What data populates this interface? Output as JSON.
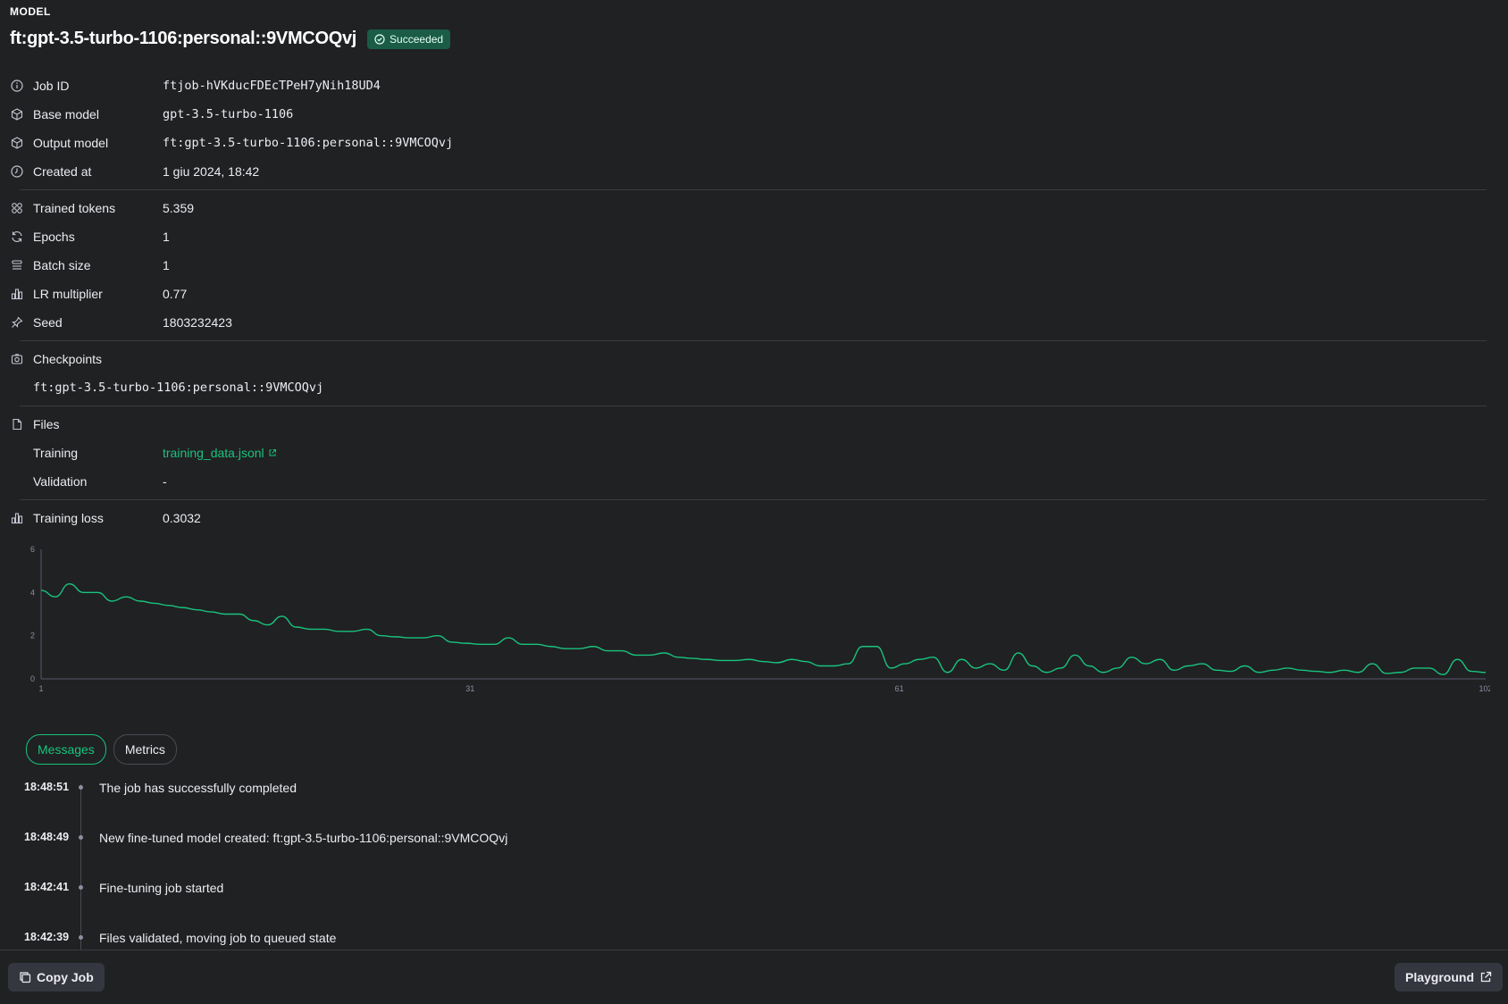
{
  "header": {
    "section_label": "MODEL",
    "title": "ft:gpt-3.5-turbo-1106:personal::9VMCOQvj",
    "status_badge": "Succeeded"
  },
  "properties": {
    "job_id": {
      "label": "Job ID",
      "value": "ftjob-hVKducFDEcTPeH7yNih18UD4"
    },
    "base_model": {
      "label": "Base model",
      "value": "gpt-3.5-turbo-1106"
    },
    "output_model": {
      "label": "Output model",
      "value": "ft:gpt-3.5-turbo-1106:personal::9VMCOQvj"
    },
    "created_at": {
      "label": "Created at",
      "value": "1 giu 2024, 18:42"
    },
    "trained_tokens": {
      "label": "Trained tokens",
      "value": "5.359"
    },
    "epochs": {
      "label": "Epochs",
      "value": "1"
    },
    "batch_size": {
      "label": "Batch size",
      "value": "1"
    },
    "lr_multiplier": {
      "label": "LR multiplier",
      "value": "0.77"
    },
    "seed": {
      "label": "Seed",
      "value": "1803232423"
    },
    "checkpoints": {
      "label": "Checkpoints",
      "value": "ft:gpt-3.5-turbo-1106:personal::9VMCOQvj"
    },
    "files": {
      "label": "Files",
      "training_label": "Training",
      "training_value": "training_data.jsonl",
      "validation_label": "Validation",
      "validation_value": "-"
    },
    "training_loss": {
      "label": "Training loss",
      "value": "0.3032"
    }
  },
  "chart_data": {
    "type": "line",
    "title": "",
    "xlabel": "",
    "ylabel": "",
    "xlim": [
      1,
      102
    ],
    "ylim": [
      0,
      6
    ],
    "x_ticks": [
      "1",
      "31",
      "61",
      "102"
    ],
    "y_ticks": [
      "0",
      "2",
      "4",
      "6"
    ],
    "color": "#19c37d",
    "series": [
      {
        "values": [
          4.1,
          3.8,
          4.4,
          4.0,
          4.0,
          3.6,
          3.8,
          3.6,
          3.5,
          3.4,
          3.3,
          3.2,
          3.1,
          3.0,
          3.0,
          2.7,
          2.5,
          2.9,
          2.4,
          2.3,
          2.3,
          2.2,
          2.2,
          2.3,
          2.0,
          1.95,
          1.9,
          1.9,
          2.0,
          1.7,
          1.65,
          1.6,
          1.6,
          1.9,
          1.6,
          1.6,
          1.5,
          1.4,
          1.4,
          1.5,
          1.3,
          1.3,
          1.1,
          1.1,
          1.2,
          1.0,
          0.95,
          0.9,
          0.85,
          0.85,
          0.9,
          0.8,
          0.75,
          0.9,
          0.8,
          0.6,
          0.6,
          0.7,
          1.5,
          1.5,
          0.5,
          0.7,
          0.9,
          1.0,
          0.3,
          0.9,
          0.5,
          0.7,
          0.4,
          1.2,
          0.6,
          0.3,
          0.5,
          1.1,
          0.6,
          0.3,
          0.5,
          1.0,
          0.7,
          0.9,
          0.4,
          0.6,
          0.7,
          0.4,
          0.35,
          0.6,
          0.3,
          0.4,
          0.5,
          0.4,
          0.35,
          0.3,
          0.4,
          0.3,
          0.7,
          0.25,
          0.3,
          0.5,
          0.5,
          0.2,
          0.9,
          0.35,
          0.3
        ]
      }
    ]
  },
  "tabs": [
    {
      "label": "Messages",
      "active": true
    },
    {
      "label": "Metrics",
      "active": false
    }
  ],
  "messages": [
    {
      "time": "18:48:51",
      "text": "The job has successfully completed"
    },
    {
      "time": "18:48:49",
      "text": "New fine-tuned model created: ft:gpt-3.5-turbo-1106:personal::9VMCOQvj"
    },
    {
      "time": "18:42:41",
      "text": "Fine-tuning job started"
    },
    {
      "time": "18:42:39",
      "text": "Files validated, moving job to queued state"
    }
  ],
  "footer": {
    "copy_job": "Copy Job",
    "playground": "Playground"
  }
}
